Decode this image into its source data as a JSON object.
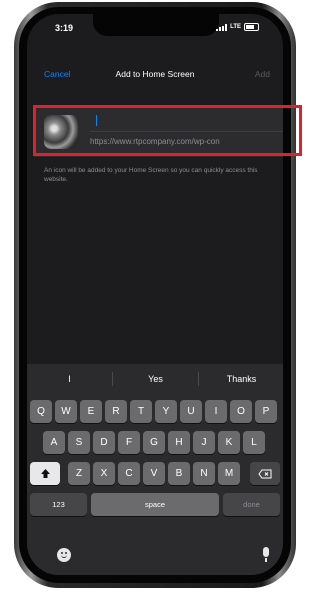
{
  "status_bar": {
    "time": "3:19",
    "network": "LTE"
  },
  "nav": {
    "cancel_label": "Cancel",
    "title": "Add to Home Screen",
    "add_label": "Add"
  },
  "card": {
    "name_value": "",
    "url": "https://www.rtpcompany.com/wp-con"
  },
  "description": "An icon will be added to your Home Screen so you can quickly access this website.",
  "keyboard": {
    "suggestions": [
      "I",
      "Yes",
      "Thanks"
    ],
    "row1": [
      "Q",
      "W",
      "E",
      "R",
      "T",
      "Y",
      "U",
      "I",
      "O",
      "P"
    ],
    "row2": [
      "A",
      "S",
      "D",
      "F",
      "G",
      "H",
      "J",
      "K",
      "L"
    ],
    "row3": [
      "Z",
      "X",
      "C",
      "V",
      "B",
      "N",
      "M"
    ],
    "numbers_label": "123",
    "space_label": "space",
    "done_label": "done"
  },
  "icons": {
    "shift": "shift-icon",
    "delete": "delete-icon",
    "emoji": "emoji-icon",
    "mic": "microphone-icon"
  },
  "colors": {
    "accent": "#0a84ff",
    "highlight": "#e0202a"
  }
}
